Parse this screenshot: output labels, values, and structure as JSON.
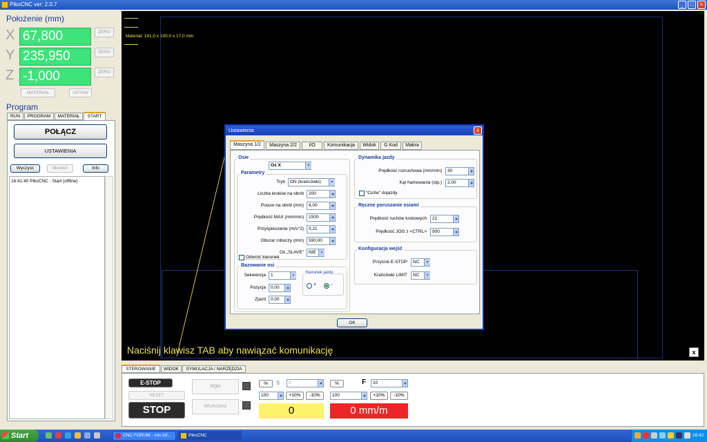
{
  "window": {
    "title": "PikoCNC ver: 2.0.7"
  },
  "position": {
    "title": "Położenie (mm)",
    "axes": [
      {
        "letter": "X",
        "value": "67,800",
        "zero": "ZERO"
      },
      {
        "letter": "Y",
        "value": "235,950",
        "zero": "ZERO"
      },
      {
        "letter": "Z",
        "value": "-1,000",
        "zero": "ZERO"
      }
    ],
    "material_label": "MATERIAŁ",
    "ustaw_label": "USTAW"
  },
  "program": {
    "title": "Program",
    "tabs": [
      "RUN",
      "PROGRAM",
      "MATERIAŁ",
      "START"
    ],
    "active_tab": "START",
    "connect_label": "POŁĄCZ",
    "settings_label": "USTAWIENIA",
    "clear_label": "Wyczyść",
    "monitor_label": "Monitor",
    "info_label": "Info",
    "log": [
      "16:41:40 PikoCNC - Start (offline)"
    ]
  },
  "workarea": {
    "material_info": "Materiał: 191,0 x 100,0 x 17,0 mm",
    "hint": "Naciśnij klawisz TAB aby nawiązać komunikację",
    "close_label": "x"
  },
  "dialog": {
    "title": "Ustawienia",
    "close_label": "x",
    "tabs": [
      "Maszyna 1/2",
      "Maszyna 2/2",
      "I/O",
      "Komunikacja",
      "Widok",
      "G Kod",
      "Makra"
    ],
    "active_tab": "Maszyna 1/2",
    "axes_group": {
      "title": "Osie",
      "selected_axis": "Oś X",
      "params_title": "Parametry",
      "mode_label": "Tryb",
      "mode_value": "ON (krańcówki)",
      "steps_label": "Liczba kroków na obrót",
      "steps_value": "200",
      "feed_label": "Posuw na obrót (mm)",
      "feed_value": "6,00",
      "maxspeed_label": "Prędkość MAX (mm/min)",
      "maxspeed_value": "1500",
      "accel_label": "Przyśpieszenie (m/s^2)",
      "accel_value": "0,21",
      "workarea_label": "Obszar roboczy (mm)",
      "workarea_value": "590,00",
      "slave_label": "Oś „SLAVE\"",
      "slave_value": "NIE",
      "reverse_label": "Odwróć kierunek",
      "homing_title": "Bazowanie osi",
      "sequence_label": "Sekwencja",
      "sequence_value": "1",
      "position_label": "Pozycja",
      "position_value": "0,00",
      "exit_label": "Zjazd",
      "exit_value": "0,00",
      "direction_title": "Kierunek jazdy",
      "dir_plus": "+",
      "dir_minus": "-"
    },
    "dynamics_group": {
      "title": "Dynamika jazdy",
      "start_speed_label": "Prędkość rozruchowa (mm/min)",
      "start_speed_value": "30",
      "brake_angle_label": "Kąt hamowania (stp.)",
      "brake_angle_value": "2,00",
      "soft_approach_label": "\"Ciche\" dojazdy"
    },
    "manual_group": {
      "title": "Ręczne poruszanie osiami",
      "step_speed_label": "Prędkość ruchów krokowych",
      "step_speed_value": "21",
      "jog_speed_label": "Prędkość  JOG z <CTRL>",
      "jog_speed_value": "900"
    },
    "inputs_group": {
      "title": "Konfiguracja wejść",
      "estop_label": "Przycisk E-STOP",
      "estop_value": "NC",
      "limit_label": "Krańcówki LIMIT",
      "limit_value": "NC"
    },
    "ok_label": "OK"
  },
  "control": {
    "tabs": [
      "STEROWANIE",
      "WIDOK",
      "SYMULACJA / NARZĘDZIA"
    ],
    "active_tab": "STEROWANIE",
    "estop_label": "E-STOP",
    "reset_label": "RESET",
    "stop_label": "STOP",
    "mgla_label": "Mgła",
    "wrzeciono_label": "Wrzeciono",
    "spindle": {
      "percent_label": "%",
      "s_label": "S",
      "s_value": "0",
      "override_value": "100",
      "plus_label": "+10%",
      "minus_label": "-10%",
      "display": "0"
    },
    "feed": {
      "percent_label": "%",
      "f_label": "F",
      "f_value": "10",
      "override_value": "100",
      "plus_label": "+10%",
      "minus_label": "-10%",
      "display": "0 mm/m"
    }
  },
  "taskbar": {
    "start_label": "Start",
    "items": [
      "CNC FORUM - cnc.inf...",
      "PikoCNC"
    ],
    "clock": "16:42"
  }
}
